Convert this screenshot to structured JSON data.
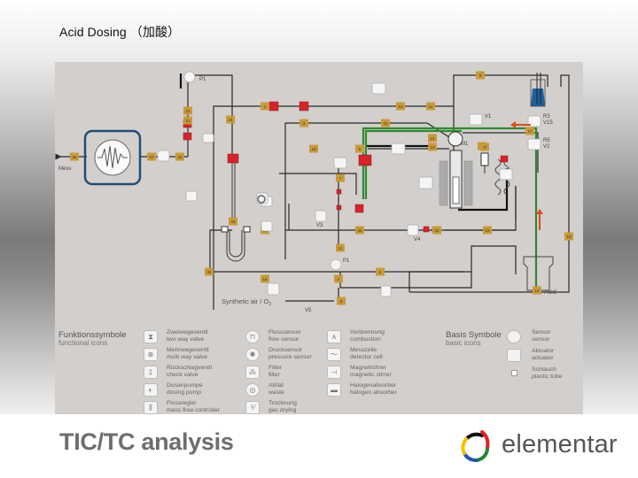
{
  "slide": {
    "title": "Acid Dosing （加酸）",
    "footer_title": "TIC/TC analysis",
    "logo_text": "elementar"
  },
  "diagram": {
    "labels": {
      "mess": "Mess",
      "synthetic_air": "Synthetic air / O",
      "synthetic_air_sub": "2",
      "acid": "Acid",
      "p1": "P1",
      "p1_flow": "P1",
      "m1": "M1",
      "v1": "V1",
      "v2": "V2",
      "v3": "V3",
      "v4": "V4",
      "v5": "V5",
      "v15": "V15",
      "r3": "R3",
      "r5": "R5"
    },
    "tube_numbers": [
      "28",
      "27",
      "25",
      "21",
      "22",
      "24",
      "2",
      "3",
      "1a",
      "1b",
      "1c",
      "1d",
      "1e",
      "1f",
      "12",
      "13",
      "14",
      "15",
      "17",
      "7",
      "11",
      "4",
      "5",
      "6",
      "8",
      "9",
      "10",
      "16",
      "23",
      "32",
      "33",
      "34",
      "35"
    ],
    "arrows": {
      "color": "#e04a1e"
    },
    "colors": {
      "line": "#2a2a2a",
      "acid_line": "#2f8a2f",
      "tube_label": "#c89a3a",
      "valve_red": "#d8232a",
      "detector_border": "#1f4e7a",
      "acid_vessel": "#1d5f9e"
    }
  },
  "legend": {
    "functional": {
      "title": "Funktionssymbole",
      "subtitle": "functional icons",
      "items": [
        {
          "icon": "two-way-valve-icon",
          "de": "Zweiwegeventil",
          "en": "two way valve"
        },
        {
          "icon": "multi-way-valve-icon",
          "de": "Mehrwegeventil",
          "en": "multi way valve"
        },
        {
          "icon": "check-valve-icon",
          "de": "Rückschlagventil",
          "en": "check valve"
        },
        {
          "icon": "dosing-pump-icon",
          "de": "Dosierpumpe",
          "en": "dosing pump"
        },
        {
          "icon": "mass-flow-controller-icon",
          "de": "Flussregler",
          "en": "mass flow controller"
        },
        {
          "icon": "flow-sensor-icon",
          "de": "Flusssensor",
          "en": "flow sensor"
        },
        {
          "icon": "pressure-sensor-icon",
          "de": "Drucksensor",
          "en": "pressure sensor"
        },
        {
          "icon": "filter-icon",
          "de": "Filter",
          "en": "filter"
        },
        {
          "icon": "waste-icon",
          "de": "Abfall",
          "en": "waste"
        },
        {
          "icon": "gas-drying-icon",
          "de": "Trocknung",
          "en": "gas drying"
        },
        {
          "icon": "combustion-icon",
          "de": "Verbrennung",
          "en": "combustion"
        },
        {
          "icon": "detector-cell-icon",
          "de": "Messzelle",
          "en": "detector cell"
        },
        {
          "icon": "magnetic-stirrer-icon",
          "de": "Magnetrührer",
          "en": "magnetic stirrer"
        },
        {
          "icon": "halogen-absorber-icon",
          "de": "Halogenabsorber",
          "en": "halogen absorber"
        }
      ]
    },
    "basic": {
      "title": "Basis Symbole",
      "subtitle": "basic icons",
      "items": [
        {
          "icon": "sensor-icon",
          "de": "Sensor",
          "en": "sensor"
        },
        {
          "icon": "actuator-icon",
          "de": "Aktuator",
          "en": "actuator"
        },
        {
          "icon": "plastic-tube-icon",
          "de": "Schlauch",
          "en": "plastic tube"
        }
      ]
    }
  }
}
